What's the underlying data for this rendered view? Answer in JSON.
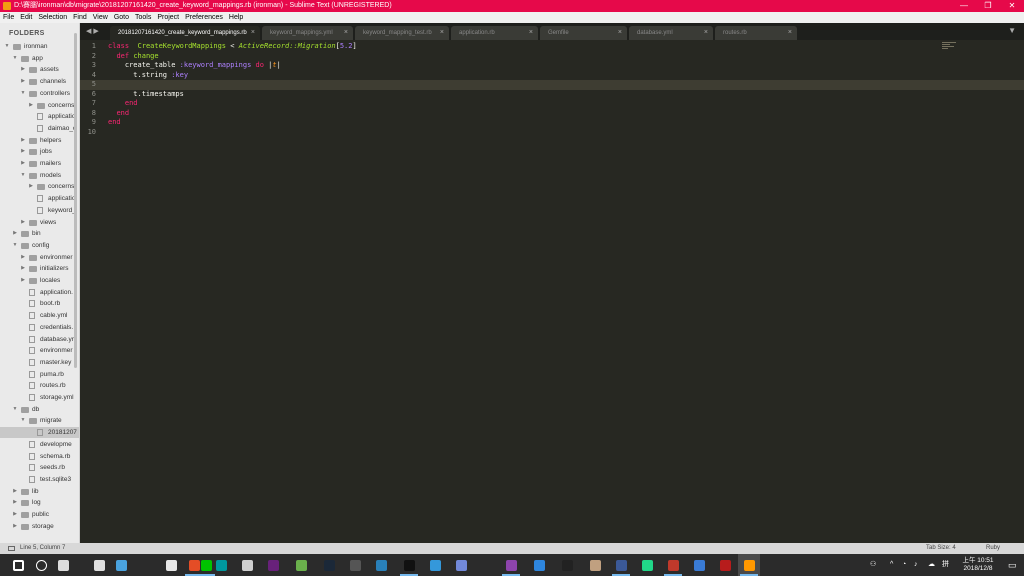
{
  "window": {
    "title": "D:\\賽腦\\ironman\\db\\migrate\\20181207161420_create_keyword_mappings.rb (ironman) - Sublime Text (UNREGISTERED)",
    "minimize": "—",
    "maximize": "❐",
    "close": "✕"
  },
  "menu": [
    "File",
    "Edit",
    "Selection",
    "Find",
    "View",
    "Goto",
    "Tools",
    "Project",
    "Preferences",
    "Help"
  ],
  "sidebar": {
    "title": "FOLDERS",
    "items": [
      {
        "label": "ironman",
        "type": "folder",
        "open": true,
        "depth": 0
      },
      {
        "label": "app",
        "type": "folder",
        "open": true,
        "depth": 1
      },
      {
        "label": "assets",
        "type": "folder",
        "open": false,
        "depth": 2
      },
      {
        "label": "channels",
        "type": "folder",
        "open": false,
        "depth": 2
      },
      {
        "label": "controllers",
        "type": "folder",
        "open": true,
        "depth": 2
      },
      {
        "label": "concerns",
        "type": "folder",
        "open": false,
        "depth": 3
      },
      {
        "label": "applicatio",
        "type": "file",
        "depth": 3
      },
      {
        "label": "daimao_c",
        "type": "file",
        "depth": 3
      },
      {
        "label": "helpers",
        "type": "folder",
        "open": false,
        "depth": 2
      },
      {
        "label": "jobs",
        "type": "folder",
        "open": false,
        "depth": 2
      },
      {
        "label": "mailers",
        "type": "folder",
        "open": false,
        "depth": 2
      },
      {
        "label": "models",
        "type": "folder",
        "open": true,
        "depth": 2
      },
      {
        "label": "concerns",
        "type": "folder",
        "open": false,
        "depth": 3
      },
      {
        "label": "applicatio",
        "type": "file",
        "depth": 3
      },
      {
        "label": "keyword_",
        "type": "file",
        "depth": 3
      },
      {
        "label": "views",
        "type": "folder",
        "open": false,
        "depth": 2
      },
      {
        "label": "bin",
        "type": "folder",
        "open": false,
        "depth": 1
      },
      {
        "label": "config",
        "type": "folder",
        "open": true,
        "depth": 1
      },
      {
        "label": "environmer",
        "type": "folder",
        "open": false,
        "depth": 2
      },
      {
        "label": "initializers",
        "type": "folder",
        "open": false,
        "depth": 2
      },
      {
        "label": "locales",
        "type": "folder",
        "open": false,
        "depth": 2
      },
      {
        "label": "application.",
        "type": "file",
        "depth": 2
      },
      {
        "label": "boot.rb",
        "type": "file",
        "depth": 2
      },
      {
        "label": "cable.yml",
        "type": "file",
        "depth": 2
      },
      {
        "label": "credentials.",
        "type": "file",
        "depth": 2
      },
      {
        "label": "database.yr",
        "type": "file",
        "depth": 2
      },
      {
        "label": "environmer",
        "type": "file",
        "depth": 2
      },
      {
        "label": "master.key",
        "type": "file",
        "depth": 2
      },
      {
        "label": "puma.rb",
        "type": "file",
        "depth": 2
      },
      {
        "label": "routes.rb",
        "type": "file",
        "depth": 2
      },
      {
        "label": "storage.yml",
        "type": "file",
        "depth": 2
      },
      {
        "label": "db",
        "type": "folder",
        "open": true,
        "depth": 1
      },
      {
        "label": "migrate",
        "type": "folder",
        "open": true,
        "depth": 2
      },
      {
        "label": "20181207",
        "type": "file",
        "depth": 3,
        "selected": true
      },
      {
        "label": "developme",
        "type": "file",
        "depth": 2
      },
      {
        "label": "schema.rb",
        "type": "file",
        "depth": 2
      },
      {
        "label": "seeds.rb",
        "type": "file",
        "depth": 2
      },
      {
        "label": "test.sqlite3",
        "type": "file",
        "depth": 2
      },
      {
        "label": "lib",
        "type": "folder",
        "open": false,
        "depth": 1
      },
      {
        "label": "log",
        "type": "folder",
        "open": false,
        "depth": 1
      },
      {
        "label": "public",
        "type": "folder",
        "open": false,
        "depth": 1
      },
      {
        "label": "storage",
        "type": "folder",
        "open": false,
        "depth": 1
      }
    ]
  },
  "tabs": [
    {
      "label": "20181207161420_create_keyword_mappings.rb",
      "active": true
    },
    {
      "label": "keyword_mappings.yml",
      "active": false
    },
    {
      "label": "keyword_mapping_test.rb",
      "active": false
    },
    {
      "label": "application.rb",
      "active": false
    },
    {
      "label": "Gemfile",
      "active": false
    },
    {
      "label": "database.yml",
      "active": false
    },
    {
      "label": "routes.rb",
      "active": false
    }
  ],
  "tab_nav": "◀ ▶",
  "tab_close": "×",
  "tab_menu": "▼",
  "editor": {
    "line_numbers": [
      "1",
      "2",
      "3",
      "4",
      "5",
      "6",
      "7",
      "8",
      "9",
      "10"
    ],
    "current_line": 5,
    "lines": [
      [
        [
          "kw",
          "class"
        ],
        [
          "",
          "  "
        ],
        [
          "cls",
          "CreateKeywordMappings"
        ],
        [
          "",
          " < "
        ],
        [
          "inh",
          "ActiveRecord::Migration"
        ],
        [
          "",
          "["
        ],
        [
          "num",
          "5.2"
        ],
        [
          "",
          "]"
        ]
      ],
      [
        [
          "",
          "  "
        ],
        [
          "kw",
          "def"
        ],
        [
          "",
          " "
        ],
        [
          "fn",
          "change"
        ]
      ],
      [
        [
          "",
          "    create_table "
        ],
        [
          "sym",
          ":keyword_mappings"
        ],
        [
          "",
          " "
        ],
        [
          "kw",
          "do"
        ],
        [
          "",
          " |"
        ],
        [
          "var",
          "t"
        ],
        [
          "",
          "|"
        ]
      ],
      [
        [
          "",
          "      t.string "
        ],
        [
          "sym",
          ":key"
        ]
      ],
      [],
      [
        [
          "",
          "      t.timestamps"
        ]
      ],
      [
        [
          "",
          "    "
        ],
        [
          "kw",
          "end"
        ]
      ],
      [
        [
          "",
          "  "
        ],
        [
          "kw",
          "end"
        ]
      ],
      [
        [
          "kw",
          "end"
        ]
      ],
      []
    ]
  },
  "statusbar": {
    "position": "Line 5, Column 7",
    "tab_size": "Tab Size: 4",
    "syntax": "Ruby"
  },
  "taskbar": {
    "icons": [
      "windows-start",
      "search",
      "task-view",
      "sublime-pinned",
      "files",
      "chrome",
      "chrome-profile",
      "line",
      "arduino",
      "image-viewer",
      "visual-studio",
      "app-home",
      "steam",
      "security",
      "mail",
      "terminal",
      "paint",
      "discord",
      "visual-studio-purple",
      "app-blue",
      "terminal-dark",
      "photos",
      "photo-editor",
      "pycharm",
      "rider",
      "translate",
      "filezilla",
      "sublime-text"
    ],
    "tray": {
      "ime": "拼",
      "clock_time": "上午 10:51",
      "clock_date": "2018/12/8"
    }
  },
  "colors": {
    "title_bar": "#e6094a",
    "editor_bg": "#272822",
    "keyword": "#f92672",
    "class_name": "#a6e22e",
    "number": "#ae81ff"
  }
}
